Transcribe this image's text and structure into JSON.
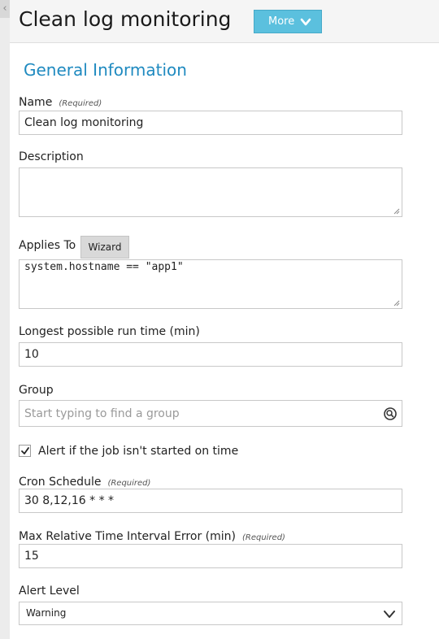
{
  "header": {
    "title": "Clean log monitoring",
    "more_label": "More"
  },
  "form": {
    "section_title": "General Information",
    "required_tag": "(Required)",
    "name": {
      "label": "Name",
      "value": "Clean log monitoring"
    },
    "description": {
      "label": "Description",
      "value": ""
    },
    "applies_to": {
      "label": "Applies To",
      "wizard_label": "Wizard",
      "value": "system.hostname == \"app1\""
    },
    "longest_run": {
      "label": "Longest possible run time (min)",
      "value": "10"
    },
    "group": {
      "label": "Group",
      "placeholder": "Start typing to find a group"
    },
    "alert_not_started": {
      "label": "Alert if the job isn't started on time",
      "checked": true
    },
    "cron": {
      "label": "Cron Schedule",
      "value": "30 8,12,16 * * *"
    },
    "max_error": {
      "label": "Max Relative Time Interval Error (min)",
      "value": "15"
    },
    "alert_level": {
      "label": "Alert Level",
      "value": "Warning"
    }
  },
  "icons": {
    "side_collapse": "chevron-left-icon",
    "more": "chevron-down-icon",
    "group_search": "search-icon",
    "alert_level": "chevron-down-icon"
  },
  "colors": {
    "accent": "#1f8ac0",
    "button": "#5bc0de"
  }
}
